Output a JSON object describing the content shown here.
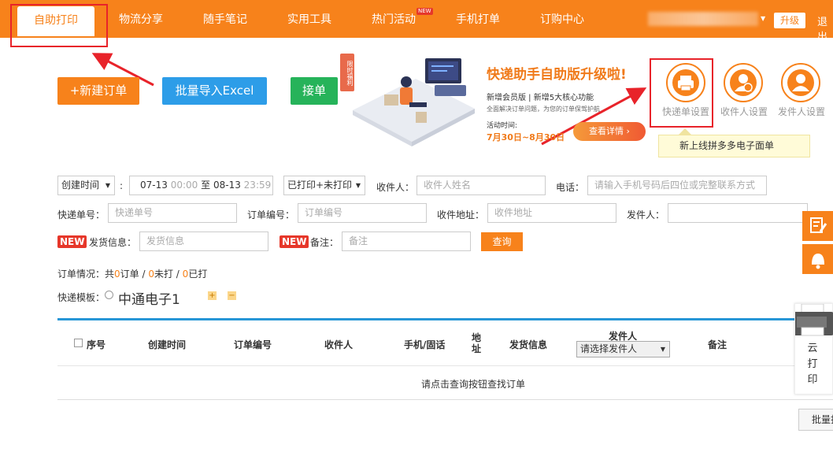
{
  "nav": {
    "items": [
      "自助打印",
      "物流分享",
      "随手笔记",
      "实用工具",
      "热门活动",
      "手机打单",
      "订购中心"
    ],
    "new_badge": "NEW",
    "upgrade": "升级",
    "logout": "退出"
  },
  "actions": {
    "new_order": "+新建订单",
    "import_excel": "批量导入Excel",
    "receive_order": "接单"
  },
  "banner": {
    "tag": "限时福利",
    "title": "快递助手自助版升级啦!",
    "subtitle": "新增会员版 | 新增5大核心功能",
    "desc": "全面解决订单问题，为您的订单保驾护航",
    "time_label": "活动时间:",
    "time": "7月30日~8月30日",
    "detail_button": "查看详情 ›"
  },
  "settings": {
    "express_template": "快递单设置",
    "receiver": "收件人设置",
    "sender": "发件人设置",
    "tooltip": "新上线拼多多电子面单"
  },
  "filters": {
    "time_type": "创建时间",
    "colon": ":",
    "date_start": "07-13",
    "time_start": "00:00",
    "to": "至",
    "date_end": "08-13",
    "time_end": "23:59",
    "print_status": "已打印+未打印",
    "receiver_label": "收件人：",
    "receiver_placeholder": "收件人姓名",
    "phone_label": "电话：",
    "phone_placeholder": "请输入手机号码后四位或完整联系方式",
    "tracking_label": "快递单号：",
    "tracking_placeholder": "快递单号",
    "order_no_label": "订单编号：",
    "order_no_placeholder": "订单编号",
    "address_label": "收件地址：",
    "address_placeholder": "收件地址",
    "sender_label": "发件人：",
    "new_tag": "NEW",
    "ship_info_label": "发货信息：",
    "ship_info_placeholder": "发货信息",
    "remark_label": "备注：",
    "remark_placeholder": "备注",
    "query": "查询"
  },
  "summary": {
    "prefix": "订单情况：共",
    "total": "0",
    "total_unit": "订单 / ",
    "unprinted": "0",
    "unprinted_unit": "未打 / ",
    "printed": "0",
    "printed_unit": "已打"
  },
  "template": {
    "label": "快递模板：",
    "name": "中通电子1",
    "add": "+",
    "remove": "−"
  },
  "table": {
    "headers": [
      "序号",
      "创建时间",
      "订单编号",
      "收件人",
      "手机/固话",
      "地址",
      "发货信息",
      "发件人",
      "备注"
    ],
    "sender_select": "请选择发件人",
    "empty": "请点击查询按钮查找订单"
  },
  "batch_button": "批量打印",
  "cloud_print": "云打印",
  "colors": {
    "brand_orange": "#f7821b",
    "blue": "#2d9de8",
    "green": "#26b35a",
    "annotation_red": "#e8232a",
    "table_line": "#2796d6"
  }
}
